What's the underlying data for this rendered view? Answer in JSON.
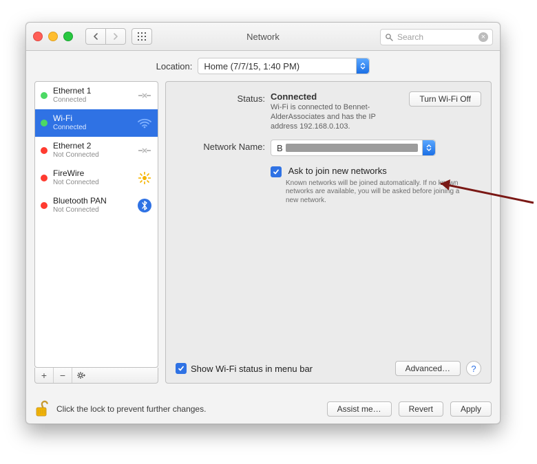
{
  "window": {
    "title": "Network"
  },
  "search": {
    "placeholder": "Search"
  },
  "location": {
    "label": "Location:",
    "value": "Home (7/7/15, 1:40 PM)"
  },
  "interfaces": [
    {
      "name": "Ethernet 1",
      "status": "Connected",
      "dot": "green",
      "selected": false,
      "icon": "ethernet"
    },
    {
      "name": "Wi-Fi",
      "status": "Connected",
      "dot": "green",
      "selected": true,
      "icon": "wifi"
    },
    {
      "name": "Ethernet 2",
      "status": "Not Connected",
      "dot": "red",
      "selected": false,
      "icon": "ethernet"
    },
    {
      "name": "FireWire",
      "status": "Not Connected",
      "dot": "red",
      "selected": false,
      "icon": "firewire"
    },
    {
      "name": "Bluetooth PAN",
      "status": "Not Connected",
      "dot": "red",
      "selected": false,
      "icon": "bluetooth"
    }
  ],
  "detail": {
    "status_label": "Status:",
    "status_value": "Connected",
    "status_info": "Wi-Fi is connected to Bennet-AlderAssociates and has the IP address 192.168.0.103.",
    "wifi_toggle": "Turn Wi-Fi Off",
    "network_name_label": "Network Name:",
    "network_name_prefix": "B",
    "ask_join_label": "Ask to join new networks",
    "ask_join_hint": "Known networks will be joined automatically. If no known networks are available, you will be asked before joining a new network.",
    "show_menubar_label": "Show Wi-Fi status in menu bar",
    "advanced": "Advanced…"
  },
  "footer": {
    "lock_text": "Click the lock to prevent further changes.",
    "assist": "Assist me…",
    "revert": "Revert",
    "apply": "Apply"
  }
}
